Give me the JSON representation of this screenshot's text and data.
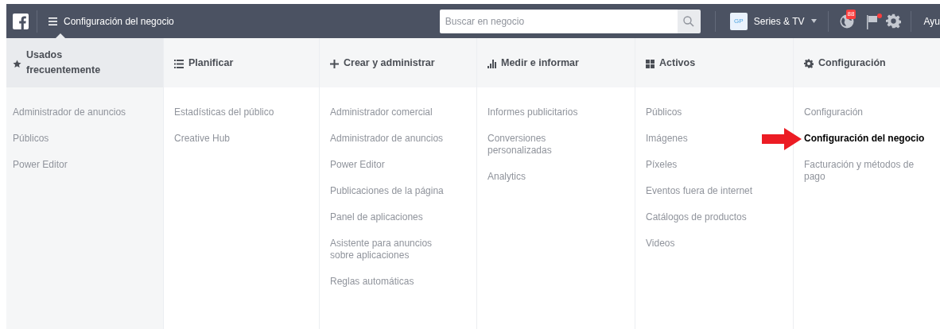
{
  "topbar": {
    "title": "Configuración del negocio",
    "search": {
      "placeholder": "Buscar en negocio"
    },
    "account": {
      "initials": "GP",
      "name": "Series & TV"
    },
    "notification_count": "88",
    "flag_alert": true,
    "help": "Ayu"
  },
  "columns": [
    {
      "title": "Usados frecuentemente",
      "selected": true,
      "items": [
        {
          "label": "Administrador de anuncios",
          "highlighted": false
        },
        {
          "label": "Públicos",
          "highlighted": false
        },
        {
          "label": "Power Editor",
          "highlighted": false
        }
      ]
    },
    {
      "title": "Planificar",
      "selected": false,
      "items": [
        {
          "label": "Estadísticas del público",
          "highlighted": false
        },
        {
          "label": "Creative Hub",
          "highlighted": false
        }
      ]
    },
    {
      "title": "Crear y administrar",
      "selected": false,
      "items": [
        {
          "label": "Administrador comercial",
          "highlighted": false
        },
        {
          "label": "Administrador de anuncios",
          "highlighted": false
        },
        {
          "label": "Power Editor",
          "highlighted": false
        },
        {
          "label": "Publicaciones de la página",
          "highlighted": false
        },
        {
          "label": "Panel de aplicaciones",
          "highlighted": false
        },
        {
          "label": "Asistente para anuncios sobre aplicaciones",
          "highlighted": false
        },
        {
          "label": "Reglas automáticas",
          "highlighted": false
        }
      ]
    },
    {
      "title": "Medir e informar",
      "selected": false,
      "items": [
        {
          "label": "Informes publicitarios",
          "highlighted": false
        },
        {
          "label": "Conversiones personalizadas",
          "highlighted": false
        },
        {
          "label": "Analytics",
          "highlighted": false
        }
      ]
    },
    {
      "title": "Activos",
      "selected": false,
      "items": [
        {
          "label": "Públicos",
          "highlighted": false
        },
        {
          "label": "Imágenes",
          "highlighted": false
        },
        {
          "label": "Píxeles",
          "highlighted": false
        },
        {
          "label": "Eventos fuera de internet",
          "highlighted": false
        },
        {
          "label": "Catálogos de productos",
          "highlighted": false
        },
        {
          "label": "Videos",
          "highlighted": false
        }
      ]
    },
    {
      "title": "Configuración",
      "selected": false,
      "items": [
        {
          "label": "Configuración",
          "highlighted": false
        },
        {
          "label": "Configuración del negocio",
          "highlighted": true
        },
        {
          "label": "Facturación y métodos de pago",
          "highlighted": false
        }
      ]
    }
  ]
}
